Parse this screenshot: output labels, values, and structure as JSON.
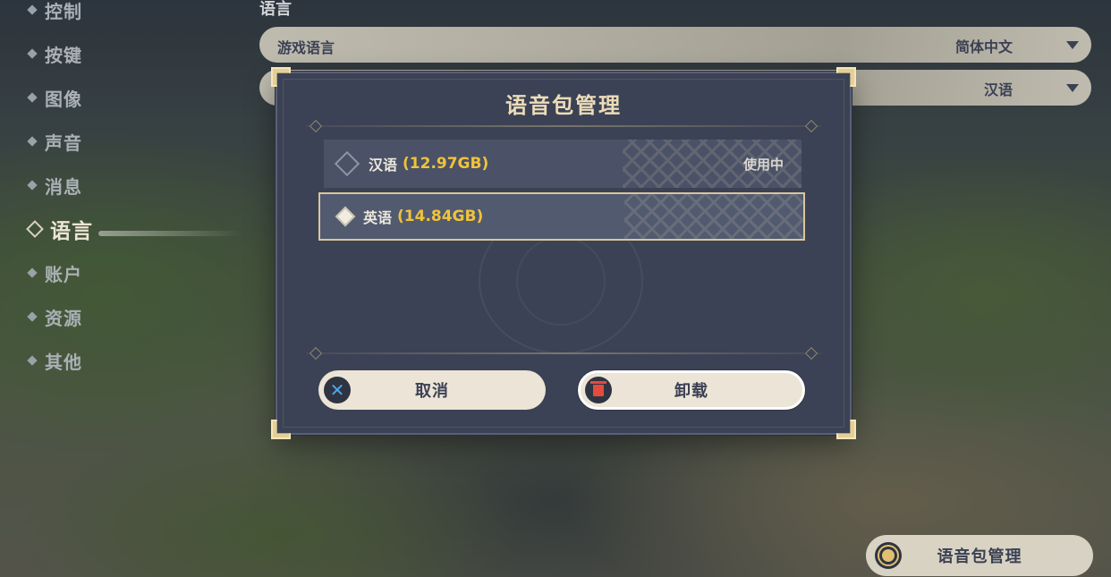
{
  "menu": {
    "items": [
      {
        "label": "控制"
      },
      {
        "label": "按键"
      },
      {
        "label": "图像"
      },
      {
        "label": "声音"
      },
      {
        "label": "消息"
      },
      {
        "label": "语言"
      },
      {
        "label": "账户"
      },
      {
        "label": "资源"
      },
      {
        "label": "其他"
      }
    ],
    "active": "语言"
  },
  "section": {
    "title": "语言",
    "rows": [
      {
        "name": "游戏语言",
        "value": "简体中文"
      },
      {
        "name": "",
        "value": "汉语"
      }
    ]
  },
  "dialog": {
    "title": "语音包管理",
    "items": [
      {
        "name": "汉语",
        "size": "(12.97GB)",
        "status": "使用中",
        "selected": false
      },
      {
        "name": "英语",
        "size": "(14.84GB)",
        "status": "",
        "selected": true
      }
    ],
    "buttons": {
      "cancel": "取消",
      "uninstall": "卸载"
    }
  },
  "bottom_button": {
    "label": "语音包管理"
  },
  "icons": {
    "cancel": "x-icon",
    "uninstall": "trash-icon",
    "bottom": "gear-icon"
  },
  "colors": {
    "dialog_bg": "#3c4255",
    "accent_gold": "#f0c33a",
    "border_gold": "#d8c79c",
    "button_bg": "#ece4d6",
    "delete_red": "#e34b3c",
    "cancel_blue": "#4fa6e8"
  }
}
